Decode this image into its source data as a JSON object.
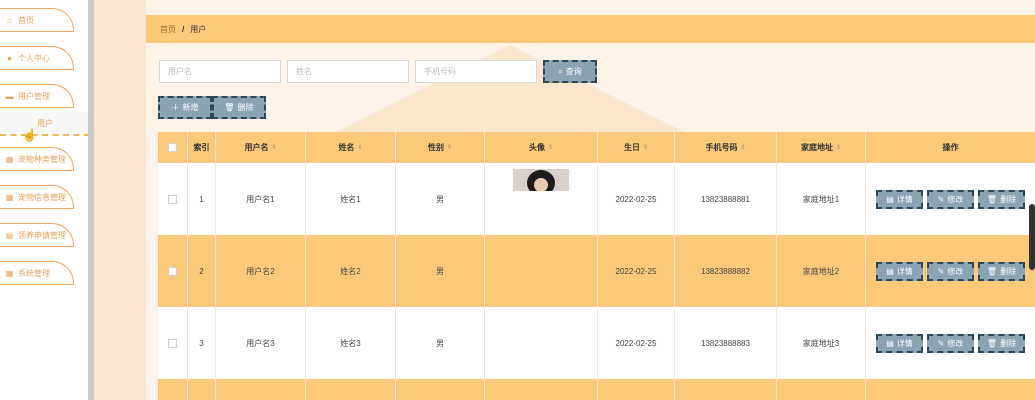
{
  "sidebar": {
    "items": [
      {
        "label": "首页",
        "icon": "home-icon",
        "glyph": "⌂"
      },
      {
        "label": "个人中心",
        "icon": "user-icon",
        "glyph": "●"
      },
      {
        "label": "用户管理",
        "icon": "users-icon",
        "glyph": "▬"
      },
      {
        "label": "宠物种类管理",
        "icon": "grid-icon",
        "glyph": "▦"
      },
      {
        "label": "宠物信息管理",
        "icon": "grid-icon",
        "glyph": "▦"
      },
      {
        "label": "领养申请管理",
        "icon": "list-icon",
        "glyph": "▤"
      },
      {
        "label": "系统管理",
        "icon": "grid-icon",
        "glyph": "▦"
      }
    ],
    "sub_item": "用户"
  },
  "breadcrumb": {
    "home": "首页",
    "current": "用户"
  },
  "search": {
    "username_placeholder": "用户名",
    "name_placeholder": "姓名",
    "phone_placeholder": "手机号码",
    "query_label": "查询"
  },
  "actions": {
    "add_label": "新增",
    "delete_label": "删除"
  },
  "table": {
    "columns": [
      "索引",
      "用户名",
      "姓名",
      "性别",
      "头像",
      "生日",
      "手机号码",
      "家庭地址",
      "操作"
    ],
    "rows": [
      {
        "index": "1",
        "username": "用户名1",
        "name": "姓名1",
        "gender": "男",
        "birthday": "2022-02-25",
        "phone": "13823888881",
        "address": "家庭地址1"
      },
      {
        "index": "2",
        "username": "用户名2",
        "name": "姓名2",
        "gender": "男",
        "birthday": "2022-02-25",
        "phone": "13823888882",
        "address": "家庭地址2"
      },
      {
        "index": "3",
        "username": "用户名3",
        "name": "姓名3",
        "gender": "男",
        "birthday": "2022-02-25",
        "phone": "13823888883",
        "address": "家庭地址3"
      }
    ],
    "row_buttons": {
      "detail": "详情",
      "edit": "修改",
      "delete": "删除"
    }
  },
  "colors": {
    "accent": "#fcc97a",
    "button": "#8aa4b4",
    "border_orange": "#f0a55c"
  }
}
